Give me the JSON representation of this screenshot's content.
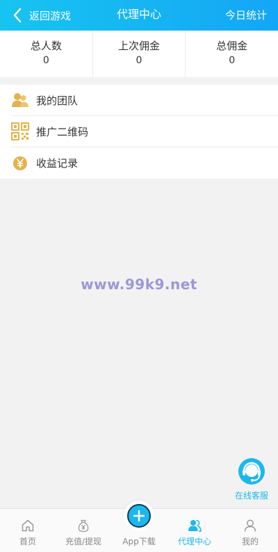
{
  "header": {
    "back_label": "返回游戏",
    "title": "代理中心",
    "right_label": "今日统计"
  },
  "stats": [
    {
      "label": "总人数",
      "value": "0"
    },
    {
      "label": "上次佣金",
      "value": "0"
    },
    {
      "label": "总佣金",
      "value": "0"
    }
  ],
  "menu": [
    {
      "label": "我的团队",
      "icon": "team-icon"
    },
    {
      "label": "推广二维码",
      "icon": "qrcode-icon"
    },
    {
      "label": "收益记录",
      "icon": "yen-coin-icon"
    }
  ],
  "watermark": "www.99k9.net",
  "customer_service": {
    "label": "在线客服",
    "icon": "headset-icon"
  },
  "tabs": [
    {
      "label": "首页",
      "icon": "home-icon"
    },
    {
      "label": "充值/提现",
      "icon": "money-bag-icon"
    },
    {
      "label": "App下载",
      "icon": "plus-icon"
    },
    {
      "label": "代理中心",
      "icon": "agent-icon"
    },
    {
      "label": "我的",
      "icon": "user-icon"
    }
  ],
  "colors": {
    "header_start": "#17c4f0",
    "header_end": "#14a6f6",
    "accent": "#1cb8ec",
    "gold_icon": "#e3b24a",
    "watermark": "#9a98d8"
  }
}
